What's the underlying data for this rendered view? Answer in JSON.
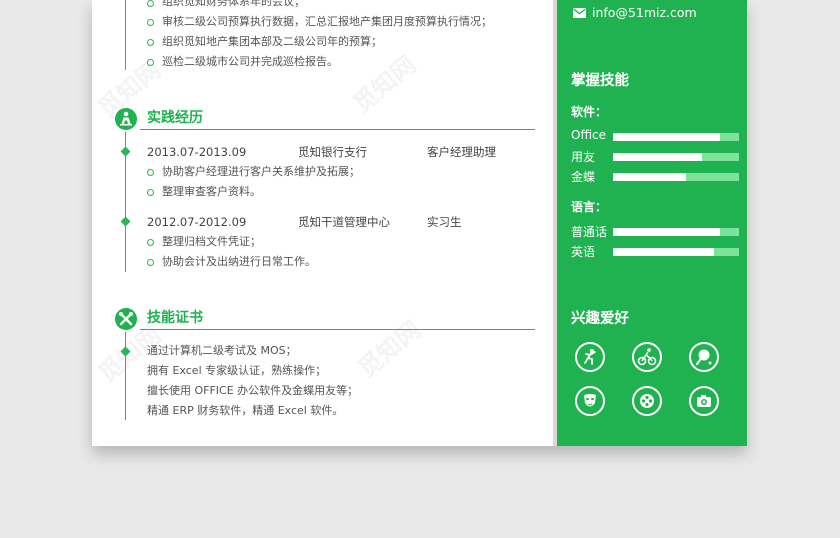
{
  "work": {
    "bullets": [
      "组织觅知财务体系年的会议；",
      "审核二级公司预算执行数据，汇总汇报地产集团月度预算执行情况；",
      "组织觅知地产集团本部及二级公司年的预算；",
      "巡检二级城市公司并完成巡检报告。"
    ]
  },
  "practice": {
    "title": "实践经历",
    "entries": [
      {
        "date": "2013.07-2013.09",
        "org": "觅知银行支行",
        "role": "客户经理助理",
        "items": [
          "协助客户经理进行客户关系维护及拓展；",
          "整理审查客户资料。"
        ]
      },
      {
        "date": "2012.07-2012.09",
        "org": "觅知干道管理中心",
        "role": "实习生",
        "items": [
          "整理归档文件凭证；",
          "协助会计及出纳进行日常工作。"
        ]
      }
    ]
  },
  "skills_cert": {
    "title": "技能证书",
    "items": [
      "通过计算机二级考试及 MOS；",
      "拥有 Excel 专家级认证，熟练操作；",
      "擅长使用 OFFICE 办公软件及金蝶用友等；",
      "精通 ERP 财务软件，精通 Excel 软件。"
    ]
  },
  "sidebar": {
    "email": "info@51miz.com",
    "skills_title": "掌握技能",
    "software_label": "软件：",
    "software": [
      {
        "name": "Office",
        "level": 0.85
      },
      {
        "name": "用友",
        "level": 0.71
      },
      {
        "name": "金蝶",
        "level": 0.58
      }
    ],
    "language_label": "语言：",
    "languages": [
      {
        "name": "普通话",
        "level": 0.85
      },
      {
        "name": "英语",
        "level": 0.8
      }
    ],
    "hobbies_title": "兴趣爱好",
    "hobbies": [
      "dance-icon",
      "cycling-icon",
      "table-tennis-icon",
      "mask-icon",
      "film-icon",
      "camera-icon"
    ]
  },
  "watermark": "觅知网",
  "colors": {
    "accent": "#20b150",
    "paper": "#ffffff",
    "background": "#e9e9e9"
  }
}
